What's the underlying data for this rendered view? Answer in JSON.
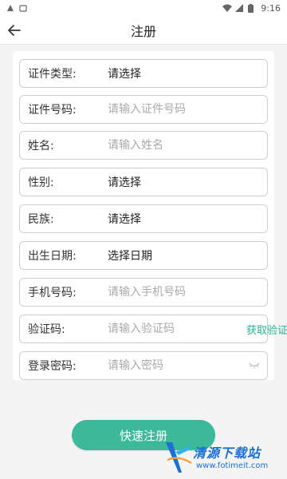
{
  "status_bar": {
    "time": "9:16",
    "left_icons": [
      "alert-icon",
      "android-icon"
    ],
    "right_icons": [
      "wifi-icon",
      "signal-icon",
      "battery-icon"
    ]
  },
  "header": {
    "title": "注册",
    "back_icon": "arrow-left-icon"
  },
  "form": {
    "fields": [
      {
        "label": "证件类型:",
        "value": "请选择",
        "type": "select"
      },
      {
        "label": "证件号码:",
        "placeholder": "请输入证件号码",
        "type": "input"
      },
      {
        "label": "姓名:",
        "placeholder": "请输入姓名",
        "type": "input"
      },
      {
        "label": "性别:",
        "value": "请选择",
        "type": "select"
      },
      {
        "label": "民族:",
        "value": "请选择",
        "type": "select"
      },
      {
        "label": "出生日期:",
        "value": "选择日期",
        "type": "select"
      },
      {
        "label": "手机号码:",
        "placeholder": "请输入手机号码",
        "type": "input"
      },
      {
        "label": "验证码:",
        "placeholder": "请输入验证码",
        "type": "input",
        "action": "获取验证码"
      },
      {
        "label": "登录密码:",
        "placeholder": "请输入密码",
        "type": "password",
        "icon": "eye-closed-icon"
      }
    ]
  },
  "register_button": {
    "label": "快速注册"
  },
  "watermark": {
    "name": "清源下载站",
    "url": "www.fotimeit.com"
  },
  "colors": {
    "accent": "#3cb99b",
    "code_link": "#2bb08f",
    "watermark": "#1a6fd8"
  }
}
